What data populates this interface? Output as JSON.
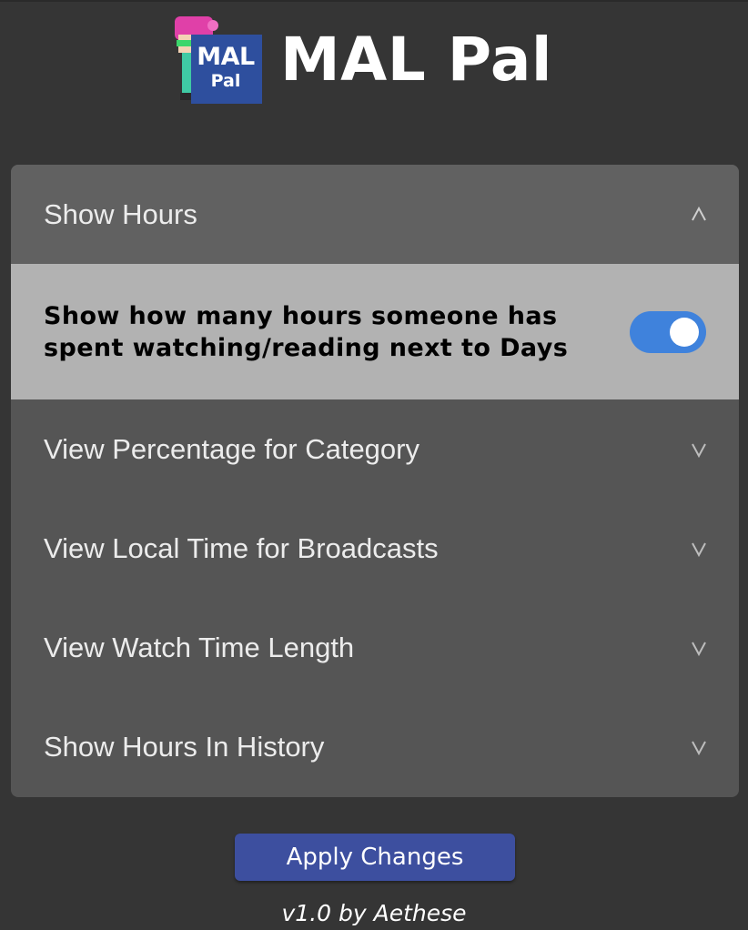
{
  "app": {
    "title": "MAL Pal",
    "logo_line1": "MAL",
    "logo_line2": "Pal",
    "version": "v1.0 by Aethese"
  },
  "colors": {
    "background": "#353535",
    "panel": "#555555",
    "open_header": "#616161",
    "body_panel": "#b2b2b2",
    "toggle_on": "#3f82dc",
    "apply_button": "#3d4f9f"
  },
  "settings": [
    {
      "label": "Show Hours",
      "expanded": true,
      "chevron": "chevron-up-icon",
      "description": "Show how many hours someone has spent watching/reading next to Days",
      "enabled": true
    },
    {
      "label": "View Percentage for Category",
      "expanded": false,
      "chevron": "chevron-down-icon"
    },
    {
      "label": "View Local Time for Broadcasts",
      "expanded": false,
      "chevron": "chevron-down-icon"
    },
    {
      "label": "View Watch Time Length",
      "expanded": false,
      "chevron": "chevron-down-icon"
    },
    {
      "label": "Show Hours In History",
      "expanded": false,
      "chevron": "chevron-down-icon"
    }
  ],
  "buttons": {
    "apply_label": "Apply Changes"
  }
}
